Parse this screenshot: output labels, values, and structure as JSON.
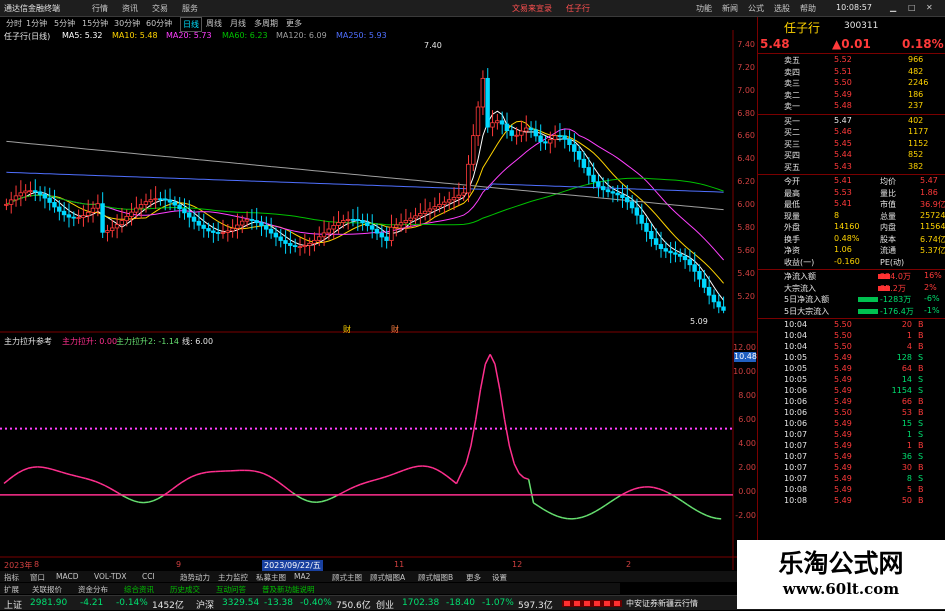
{
  "menubar": {
    "app_title": "通达信金融终端",
    "items": [
      "行情",
      "资讯",
      "交易",
      "服务"
    ],
    "center_items": [
      "文易来宣录",
      "任子行"
    ],
    "right_items": [
      "功能",
      "新闻",
      "公式",
      "选股",
      "帮助"
    ],
    "time": "10:08:57"
  },
  "period_tabs": [
    "分时",
    "1分钟",
    "5分钟",
    "15分钟",
    "30分钟",
    "60分钟",
    "日线",
    "周线",
    "月线",
    "多周期",
    "更多"
  ],
  "ma_line": {
    "stock": "任子行(日线)",
    "ma5": "MA5: 5.32",
    "ma10": "MA10: 5.48",
    "ma20": "MA20: 5.73",
    "ma60": "MA60: 6.23",
    "ma120": "MA120: 6.09",
    "ma250": "MA250: 5.93"
  },
  "price_axis": [
    "7.40",
    "7.20",
    "7.00",
    "6.80",
    "6.60",
    "6.40",
    "6.20",
    "6.00",
    "5.80",
    "5.60",
    "5.40",
    "5.20"
  ],
  "annotations": {
    "high": "7.40",
    "low": "5.09"
  },
  "markers": [
    "财",
    "财"
  ],
  "indicator": {
    "name": "主力拉升参考",
    "line1": "主力拉升: 0.00",
    "line2": "主力拉升2: -1.14",
    "line3": "线: 6.00",
    "axis": [
      "12.00",
      "10.00",
      "8.00",
      "6.00",
      "4.00",
      "2.00",
      "0.00",
      "-2.00"
    ],
    "current_tag": "10.48"
  },
  "date_axis": [
    "2023年",
    "8",
    "9",
    "2023/09/22/五",
    "11",
    "12",
    "2"
  ],
  "quote": {
    "name": "任子行",
    "code": "300311",
    "price": "5.48",
    "change": "▲0.01",
    "pct": "0.18%",
    "asks": [
      {
        "label": "卖五",
        "price": "5.52",
        "vol": "966"
      },
      {
        "label": "卖四",
        "price": "5.51",
        "vol": "482"
      },
      {
        "label": "卖三",
        "price": "5.50",
        "vol": "2246"
      },
      {
        "label": "卖二",
        "price": "5.49",
        "vol": "186"
      },
      {
        "label": "卖一",
        "price": "5.48",
        "vol": "237"
      }
    ],
    "bids": [
      {
        "label": "买一",
        "price": "5.47",
        "vol": "402"
      },
      {
        "label": "买二",
        "price": "5.46",
        "vol": "1177"
      },
      {
        "label": "买三",
        "price": "5.45",
        "vol": "1152"
      },
      {
        "label": "买四",
        "price": "5.44",
        "vol": "852"
      },
      {
        "label": "买五",
        "price": "5.43",
        "vol": "382"
      }
    ],
    "stats": [
      {
        "l1": "今开",
        "v1": "5.41",
        "l2": "均价",
        "v2": "5.47"
      },
      {
        "l1": "最高",
        "v1": "5.53",
        "l2": "量比",
        "v2": "1.86"
      },
      {
        "l1": "最低",
        "v1": "5.41",
        "l2": "市值",
        "v2": "36.9亿"
      },
      {
        "l1": "现量",
        "v1": "8",
        "l2": "总量",
        "v2": "25724"
      },
      {
        "l1": "外盘",
        "v1": "14160",
        "l2": "内盘",
        "v2": "11564"
      },
      {
        "l1": "换手",
        "v1": "0.48%",
        "l2": "股本",
        "v2": "6.74亿"
      },
      {
        "l1": "净资",
        "v1": "1.06",
        "l2": "流通",
        "v2": "5.37亿"
      },
      {
        "l1": "收益(一)",
        "v1": "-0.160",
        "l2": "PE(动)",
        "v2": ""
      }
    ],
    "flows": [
      {
        "label": "净流入额",
        "value": "224.0万",
        "pct": "16%"
      },
      {
        "label": "大宗流入",
        "value": "35.2万",
        "pct": "2%"
      },
      {
        "label": "5日净流入额",
        "value": "-1283万",
        "pct": "-6%"
      },
      {
        "label": "5日大宗流入",
        "value": "-176.4万",
        "pct": "-1%"
      }
    ],
    "ticks": [
      {
        "t": "10:04",
        "p": "5.50",
        "v": "20",
        "d": "B"
      },
      {
        "t": "10:04",
        "p": "5.50",
        "v": "1",
        "d": "B"
      },
      {
        "t": "10:04",
        "p": "5.50",
        "v": "4",
        "d": "B"
      },
      {
        "t": "10:05",
        "p": "5.49",
        "v": "128",
        "d": "S"
      },
      {
        "t": "10:05",
        "p": "5.49",
        "v": "64",
        "d": "B"
      },
      {
        "t": "10:05",
        "p": "5.49",
        "v": "14",
        "d": "S"
      },
      {
        "t": "10:06",
        "p": "5.49",
        "v": "1154",
        "d": "S"
      },
      {
        "t": "10:06",
        "p": "5.49",
        "v": "66",
        "d": "B"
      },
      {
        "t": "10:06",
        "p": "5.50",
        "v": "53",
        "d": "B"
      },
      {
        "t": "10:06",
        "p": "5.49",
        "v": "15",
        "d": "S"
      },
      {
        "t": "10:07",
        "p": "5.49",
        "v": "1",
        "d": "S"
      },
      {
        "t": "10:07",
        "p": "5.49",
        "v": "1",
        "d": "B"
      },
      {
        "t": "10:07",
        "p": "5.49",
        "v": "36",
        "d": "S"
      },
      {
        "t": "10:07",
        "p": "5.49",
        "v": "30",
        "d": "B"
      },
      {
        "t": "10:07",
        "p": "5.49",
        "v": "8",
        "d": "S"
      },
      {
        "t": "10:08",
        "p": "5.49",
        "v": "5",
        "d": "B"
      },
      {
        "t": "10:08",
        "p": "5.49",
        "v": "50",
        "d": "B"
      }
    ]
  },
  "bottom_tabs": [
    "指标",
    "窗口",
    "MACD",
    "VOL-TDX",
    "CCI",
    "趋势动力",
    "主力监控",
    "私募主图",
    "MA2",
    "顾式主图",
    "顾式幅图A",
    "顾式幅图B",
    "更多",
    "设置"
  ],
  "func_tabs": [
    "扩展",
    "关联报价",
    "资金分布",
    "综合资讯",
    "历史成交",
    "互动问答",
    "普及新功能说明"
  ],
  "status": {
    "sh_label": "上证",
    "sh_val": "2981.90",
    "sh_chg": "-4.21",
    "sh_pct": "-0.14%",
    "sh_amt": "1452亿",
    "sz_label": "沪深",
    "sz_val": "3329.54",
    "sz_chg": "-13.38",
    "sz_pct": "-0.40%",
    "sz_amt": "750.6亿",
    "cy_label": "创业",
    "cy_val": "1702.38",
    "cy_chg": "-18.40",
    "cy_pct": "-1.07%",
    "cy_amt": "597.3亿",
    "broker": "中安证券新疆云行情"
  },
  "watermark": {
    "title": "乐淘公式网",
    "url": "www.60lt.com"
  },
  "colors": {
    "up": "#ff3a3a",
    "down": "#00d8ff",
    "ma5": "#ffffff",
    "ma10": "#ffd400",
    "ma20": "#ff40ff",
    "ma60": "#00c000",
    "ma120": "#a0a0a0",
    "ma250": "#5070ff",
    "pink": "#ff2f8e",
    "green": "#66e070"
  }
}
